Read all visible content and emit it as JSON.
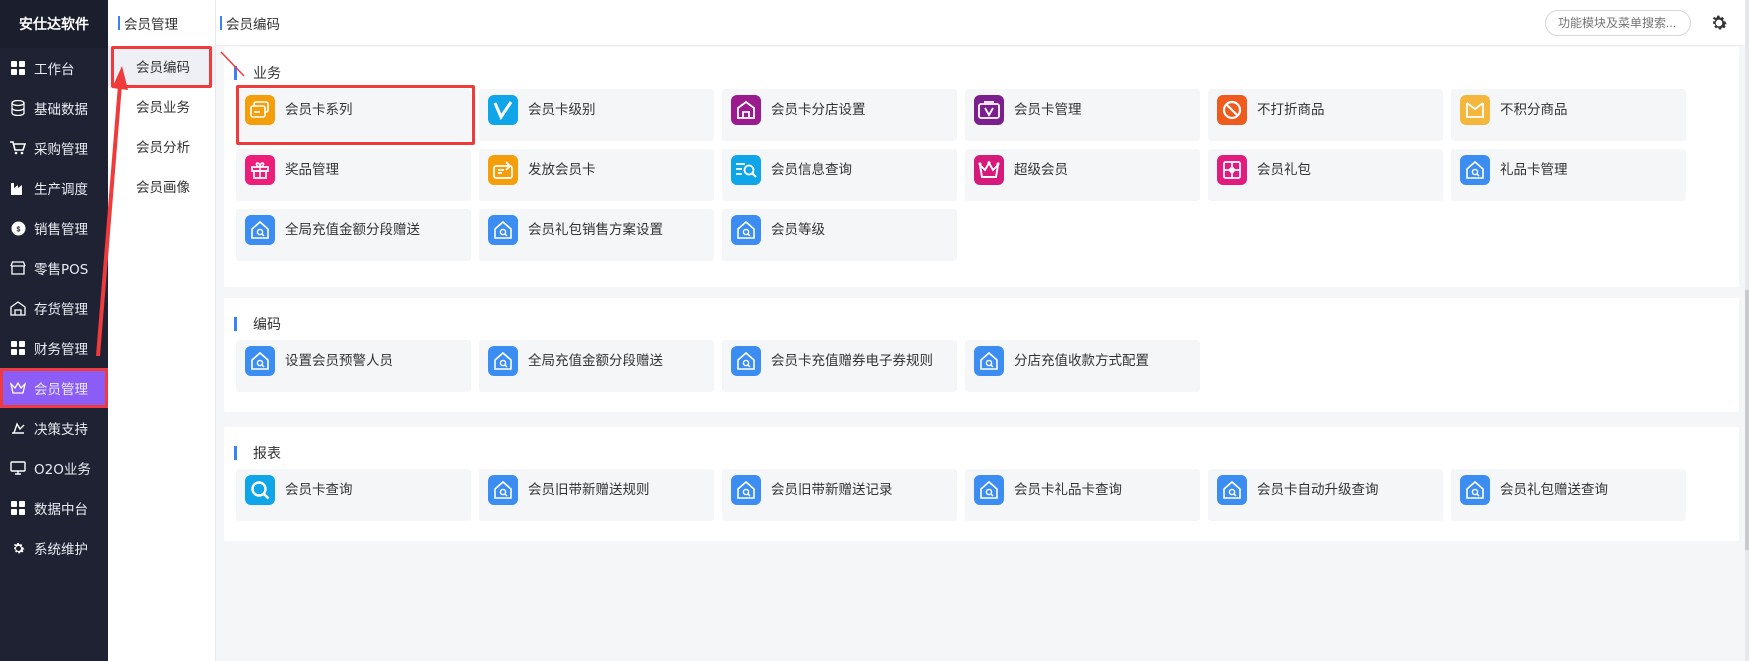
{
  "brand": "安仕达软件",
  "sidebar": {
    "items": [
      {
        "label": "工作台",
        "icon": "grid-icon"
      },
      {
        "label": "基础数据",
        "icon": "database-icon"
      },
      {
        "label": "采购管理",
        "icon": "cart-icon"
      },
      {
        "label": "生产调度",
        "icon": "factory-icon"
      },
      {
        "label": "销售管理",
        "icon": "sales-icon"
      },
      {
        "label": "零售POS",
        "icon": "store-icon"
      },
      {
        "label": "存货管理",
        "icon": "warehouse-icon"
      },
      {
        "label": "财务管理",
        "icon": "grid-icon"
      },
      {
        "label": "会员管理",
        "icon": "crown-icon"
      },
      {
        "label": "决策支持",
        "icon": "decision-icon"
      },
      {
        "label": "O2O业务",
        "icon": "monitor-icon"
      },
      {
        "label": "数据中台",
        "icon": "grid-icon"
      },
      {
        "label": "系统维护",
        "icon": "gear-icon"
      }
    ]
  },
  "submenu": {
    "title": "会员管理",
    "items": [
      "会员编码",
      "会员业务",
      "会员分析",
      "会员画像"
    ]
  },
  "topbar": {
    "title": "会员编码",
    "search_placeholder": "功能模块及菜单搜索..."
  },
  "sections": [
    {
      "title": "业务",
      "cards": [
        {
          "label": "会员卡系列",
          "icon": "card-stack-icon",
          "color": "#f59e0b"
        },
        {
          "label": "会员卡级别",
          "icon": "v-level-icon",
          "color": "#0ea5e9"
        },
        {
          "label": "会员卡分店设置",
          "icon": "store-house-icon",
          "color": "#9b1b8f"
        },
        {
          "label": "会员卡管理",
          "icon": "vip-card-icon",
          "color": "#7b1f8f"
        },
        {
          "label": "不打折商品",
          "icon": "no-discount-icon",
          "color": "#ef5a1e"
        },
        {
          "label": "不积分商品",
          "icon": "envelope-icon",
          "color": "#f5b73b"
        },
        {
          "label": "奖品管理",
          "icon": "gift-icon",
          "color": "#ec1e79"
        },
        {
          "label": "发放会员卡",
          "icon": "card-issue-icon",
          "color": "#f59e0b"
        },
        {
          "label": "会员信息查询",
          "icon": "search-list-icon",
          "color": "#0ea5e9"
        },
        {
          "label": "超级会员",
          "icon": "crown-icon",
          "color": "#d61a7b"
        },
        {
          "label": "会员礼包",
          "icon": "gift-box-icon",
          "color": "#e21b7f"
        },
        {
          "label": "礼品卡管理",
          "icon": "home-search-icon",
          "color": "#3b8df2"
        },
        {
          "label": "全局充值金额分段赠送",
          "icon": "home-search-icon",
          "color": "#3b8df2"
        },
        {
          "label": "会员礼包销售方案设置",
          "icon": "home-search-icon",
          "color": "#3b8df2"
        },
        {
          "label": "会员等级",
          "icon": "home-search-icon",
          "color": "#3b8df2"
        }
      ]
    },
    {
      "title": "编码",
      "cards": [
        {
          "label": "设置会员预警人员",
          "icon": "home-search-icon",
          "color": "#3b8df2"
        },
        {
          "label": "全局充值金额分段赠送",
          "icon": "home-search-icon",
          "color": "#3b8df2"
        },
        {
          "label": "会员卡充值赠券电子券规则",
          "icon": "home-search-icon",
          "color": "#3b8df2"
        },
        {
          "label": "分店充值收款方式配置",
          "icon": "home-search-icon",
          "color": "#3b8df2"
        }
      ]
    },
    {
      "title": "报表",
      "cards": [
        {
          "label": "会员卡查询",
          "icon": "magnifier-icon",
          "color": "#0ea5e9"
        },
        {
          "label": "会员旧带新赠送规则",
          "icon": "home-search-icon",
          "color": "#3b8df2"
        },
        {
          "label": "会员旧带新赠送记录",
          "icon": "home-search-icon",
          "color": "#3b8df2"
        },
        {
          "label": "会员卡礼品卡查询",
          "icon": "home-search-icon",
          "color": "#3b8df2"
        },
        {
          "label": "会员卡自动升级查询",
          "icon": "home-search-icon",
          "color": "#3b8df2"
        },
        {
          "label": "会员礼包赠送查询",
          "icon": "home-search-icon",
          "color": "#3b8df2"
        }
      ]
    }
  ]
}
